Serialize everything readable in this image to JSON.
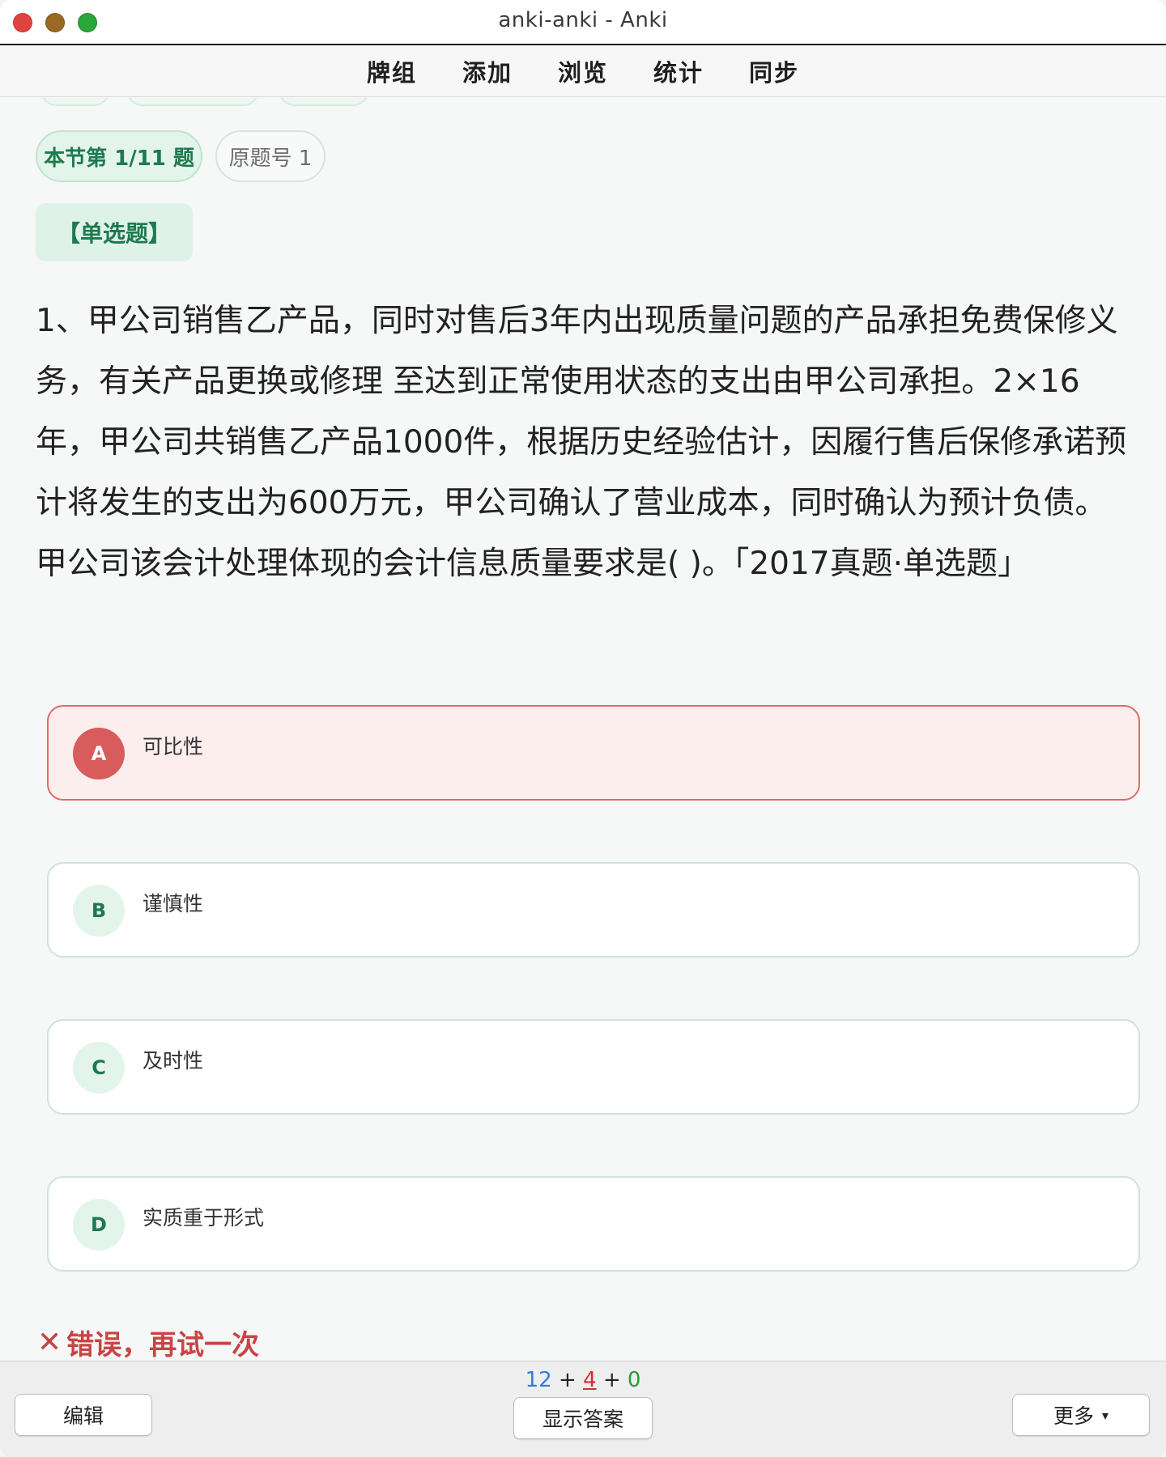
{
  "window": {
    "title": "anki-anki - Anki"
  },
  "toolbar": {
    "items": [
      "牌组",
      "添加",
      "浏览",
      "统计",
      "同步"
    ]
  },
  "card": {
    "section_label": "本节第 1/11 题",
    "original_number": "原题号 1",
    "type_tag": "【单选题】",
    "question": "1、甲公司销售乙产品，同时对售后3年内出现质量问题的产品承担免费保修义务，有关产品更换或修理 至达到正常使用状态的支出由甲公司承担。2×16年，甲公司共销售乙产品1000件，根据历史经验估计，因履行售后保修承诺预计将发生的支出为600万元，甲公司确认了营业成本，同时确认为预计负债。甲公司该会计处理体现的会计信息质量要求是( )。「2017真题·单选题」",
    "options": [
      {
        "letter": "A",
        "text": "可比性",
        "state": "wrong"
      },
      {
        "letter": "B",
        "text": "谨慎性",
        "state": "normal"
      },
      {
        "letter": "C",
        "text": "及时性",
        "state": "normal"
      },
      {
        "letter": "D",
        "text": "实质重于形式",
        "state": "normal"
      }
    ],
    "feedback": {
      "icon": "✕",
      "text": "错误，再试一次"
    }
  },
  "bottom": {
    "counts": {
      "new": "12",
      "learning": "4",
      "review": "0",
      "sep": "+"
    },
    "edit_label": "编辑",
    "show_answer_label": "显示答案",
    "more_label": "更多",
    "more_caret": "▾"
  },
  "colors": {
    "accent_green": "#1d7a4f",
    "wrong_red": "#d95c5c",
    "new_blue": "#2f7de1",
    "learn_red": "#d33030",
    "review_green": "#2a9a3c"
  }
}
